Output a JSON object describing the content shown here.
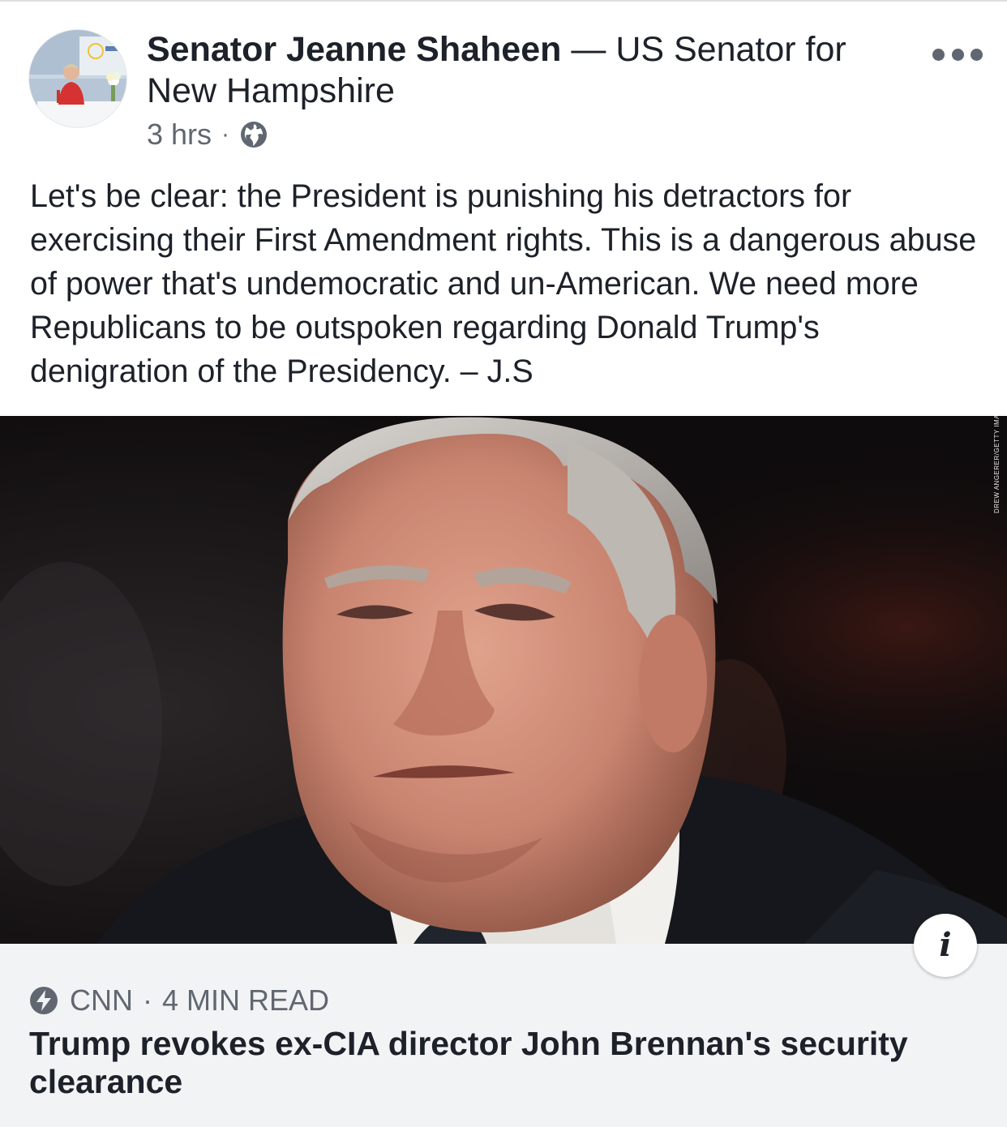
{
  "post": {
    "author_name": "Senator Jeanne Shaheen",
    "author_separator": "—",
    "author_description": "US Senator for New Hampshire",
    "timestamp": "3 hrs",
    "meta_dot": "·",
    "privacy_icon": "globe-icon",
    "more_icon": "more-options-icon",
    "body": "Let's be clear: the President is punishing his detractors for exercising their First Amendment rights. This is a dangerous abuse of power that's undemocratic and un-American. We need more Republicans to be outspoken regarding Donald Trump's denigration of the Presidency. – J.S"
  },
  "link": {
    "photo_credit": "DREW ANGERER/GETTY IMAG",
    "info_glyph": "i",
    "source_icon": "instant-article-bolt-icon",
    "source": "CNN",
    "source_sep": "·",
    "read_time": "4 MIN READ",
    "headline": "Trump revokes ex-CIA director John Brennan's security clearance"
  },
  "colors": {
    "text_primary": "#1d2129",
    "text_secondary": "#606770",
    "footer_bg": "#f2f3f5"
  }
}
